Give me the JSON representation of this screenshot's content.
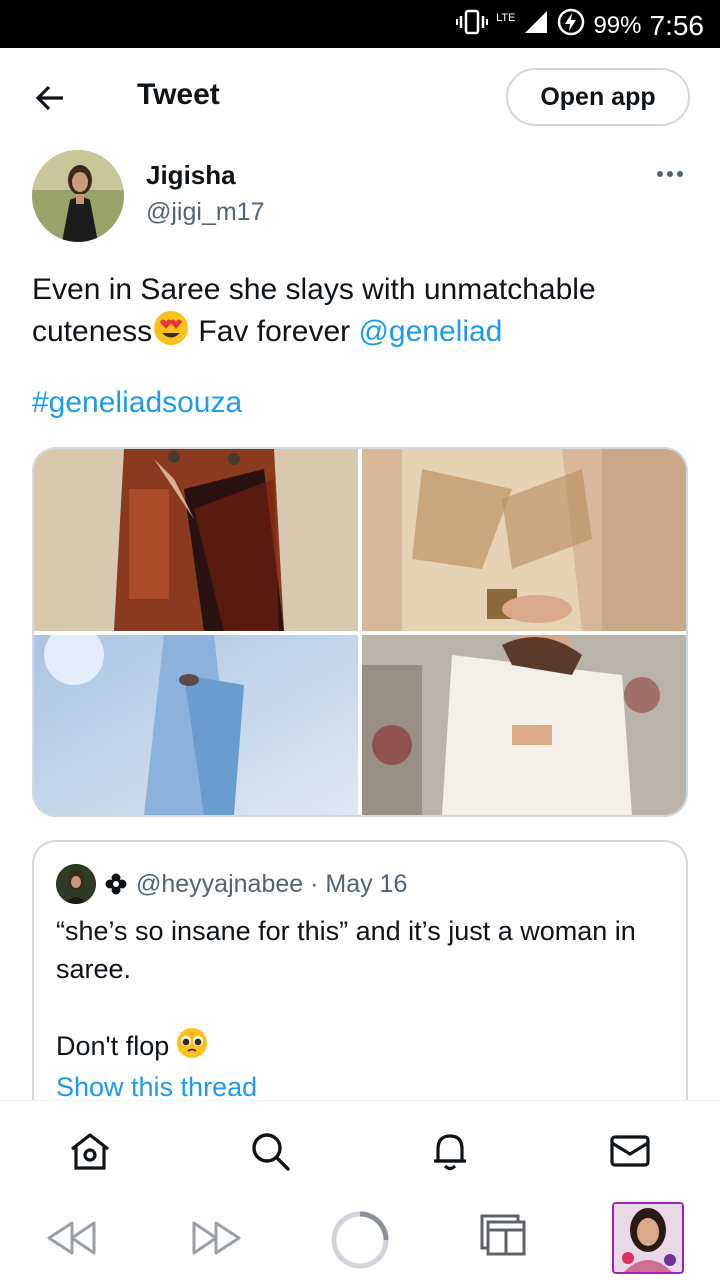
{
  "status_bar": {
    "network": "LTE",
    "battery": "99%",
    "time": "7:56"
  },
  "header": {
    "title": "Tweet",
    "open_app_label": "Open app"
  },
  "tweet": {
    "author_name": "Jigisha",
    "author_handle": "@jigi_m17",
    "text_part1": "Even in Saree she slays with unmatchable cuteness",
    "text_part2": " Fav forever ",
    "mention": "@geneliad",
    "hashtag": "#geneliadsouza"
  },
  "quoted_tweet": {
    "handle_date": "@heyyajnabee · May 16",
    "text_line1": "“she’s so insane for this” and it’s just a woman in saree.",
    "text_line2": "Don't flop",
    "show_thread_label": "Show this thread"
  },
  "bottom_nav": {
    "items": [
      "home-icon",
      "search-icon",
      "notifications-icon",
      "messages-icon"
    ]
  },
  "browser_bar": {
    "items": [
      "back-icon",
      "forward-icon",
      "reload-icon",
      "tabs-icon",
      "profile-avatar"
    ]
  },
  "colors": {
    "link": "#1d9bf0",
    "secondary_text": "#536471",
    "border": "#cfd9de"
  }
}
